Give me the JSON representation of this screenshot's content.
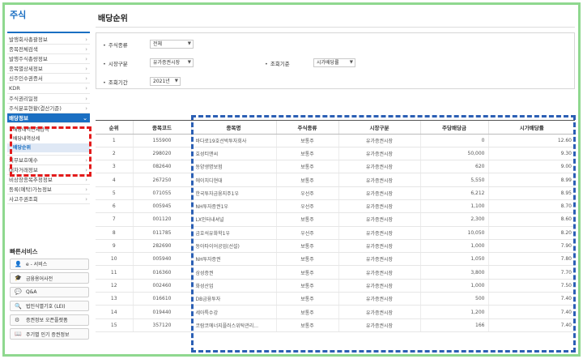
{
  "sidebar": {
    "title": "주식",
    "menu_before": [
      "발행회사총괄정보",
      "종목전체검색",
      "발행주식총량정보",
      "종목별상세정보",
      "신주인수권증서",
      "KDR",
      "주식권리일정",
      "주식분포현황(결산기준)"
    ],
    "active_menu": "배당정보",
    "submenu": [
      "배당내역전체검색",
      "배당내역상세",
      "배당순위"
    ],
    "active_submenu": "배당순위",
    "menu_after": [
      "의무보호예수",
      "대차거래정보",
      "비상장종목추정정보",
      "등록(예탁)가능정보",
      "사고주권조회"
    ],
    "quick_title": "빠른서비스",
    "quick": [
      {
        "icon": "person-icon",
        "label": "e - 서비스"
      },
      {
        "icon": "graduation-cap-icon",
        "label": "금융용어사전"
      },
      {
        "icon": "chat-bubble-icon",
        "label": "Q&A"
      },
      {
        "icon": "magnifier-icon",
        "label": "법인식별기호 (LEI)"
      },
      {
        "icon": "api-icon",
        "label": "증권정보 오픈플랫폼"
      },
      {
        "icon": "book-icon",
        "label": "주기별 인기 증권정보"
      }
    ]
  },
  "main": {
    "title": "배당순위",
    "filters": {
      "stock_type_label": "주식종류",
      "stock_type_value": "전체",
      "market_label": "시장구분",
      "market_value": "유가증권시장",
      "sort_label": "조회기준",
      "sort_value": "시가배당률",
      "period_label": "조회기간",
      "period_value": "2021년"
    },
    "table": {
      "headers": [
        "순위",
        "종목코드",
        "종목명",
        "주식종류",
        "시장구분",
        "주당배당금",
        "시가배당률"
      ],
      "rows": [
        [
          "1",
          "155900",
          "바다로19호선박투자회사",
          "보통주",
          "유가증권시장",
          "0",
          "12.60"
        ],
        [
          "2",
          "298020",
          "효성티앤씨",
          "보통주",
          "유가증권시장",
          "50,000",
          "9.30"
        ],
        [
          "3",
          "082640",
          "동양생명보험",
          "보통주",
          "유가증권시장",
          "620",
          "9.00"
        ],
        [
          "4",
          "267250",
          "에이치디현대",
          "보통주",
          "유가증권시장",
          "5,550",
          "8.99"
        ],
        [
          "5",
          "071055",
          "한국투자금융지주1우",
          "우선주",
          "유가증권시장",
          "6,212",
          "8.95"
        ],
        [
          "6",
          "005945",
          "NH투자증권1우",
          "우선주",
          "유가증권시장",
          "1,100",
          "8.70"
        ],
        [
          "7",
          "001120",
          "LX인터내셔널",
          "보통주",
          "유가증권시장",
          "2,300",
          "8.60"
        ],
        [
          "8",
          "011785",
          "금호석유화학1우",
          "우선주",
          "유가증권시장",
          "10,050",
          "8.20"
        ],
        [
          "9",
          "282690",
          "동아타이어공업(선설)",
          "보통주",
          "유가증권시장",
          "1,000",
          "7.90"
        ],
        [
          "10",
          "005940",
          "NH투자증권",
          "보통주",
          "유가증권시장",
          "1,050",
          "7.80"
        ],
        [
          "11",
          "016360",
          "삼성증권",
          "보통주",
          "유가증권시장",
          "3,800",
          "7.70"
        ],
        [
          "12",
          "002460",
          "화성산업",
          "보통주",
          "유가증권시장",
          "1,000",
          "7.50"
        ],
        [
          "13",
          "016610",
          "DB금융투자",
          "보통주",
          "유가증권시장",
          "500",
          "7.40"
        ],
        [
          "14",
          "019440",
          "세아특수강",
          "보통주",
          "유가증권시장",
          "1,200",
          "7.40"
        ],
        [
          "15",
          "357120",
          "코람코에너지플러스위탁관리...",
          "보통주",
          "유가증권시장",
          "166",
          "7.40"
        ]
      ]
    }
  },
  "colors": {
    "accent": "#1a6fc2",
    "highlight_red": "#e31b1b",
    "highlight_blue": "#2b5fb4",
    "frame_green": "#8fd88f"
  }
}
